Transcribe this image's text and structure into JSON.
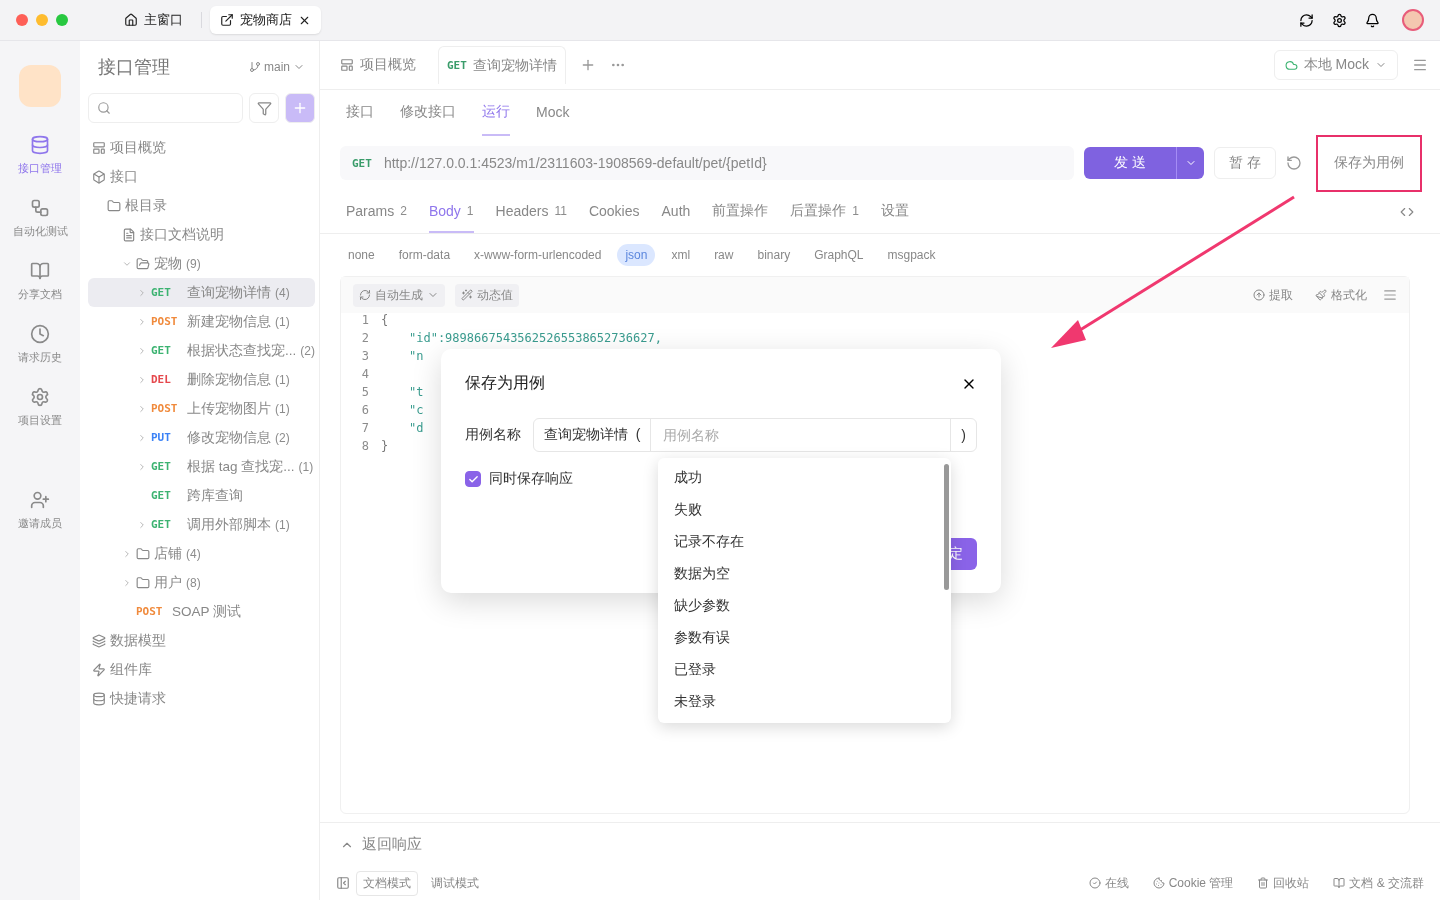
{
  "window": {
    "tabs": [
      {
        "kind": "home",
        "label": "主窗口",
        "selected": false
      },
      {
        "kind": "project",
        "label": "宠物商店",
        "selected": true
      }
    ]
  },
  "rail": [
    {
      "label": "接口管理",
      "selected": true
    },
    {
      "label": "自动化测试",
      "selected": false
    },
    {
      "label": "分享文档",
      "selected": false
    },
    {
      "label": "请求历史",
      "selected": false
    },
    {
      "label": "项目设置",
      "selected": false
    },
    {
      "label": "邀请成员",
      "selected": false
    }
  ],
  "sidebar": {
    "title": "接口管理",
    "branch": "main",
    "tree": [
      {
        "kind": "overview",
        "label": "项目概览"
      },
      {
        "kind": "section",
        "label": "接口",
        "children": [
          {
            "kind": "root",
            "label": "根目录",
            "children": [
              {
                "kind": "doc",
                "label": "接口文档说明"
              },
              {
                "kind": "folder",
                "label": "宠物",
                "count": "(9)",
                "expanded": true,
                "children": [
                  {
                    "kind": "endpoint",
                    "method": "GET",
                    "color": "#3cb371",
                    "label": "查询宠物详情",
                    "count": "(4)",
                    "selected": true,
                    "expandable": true
                  },
                  {
                    "kind": "endpoint",
                    "method": "POST",
                    "color": "#f08a3c",
                    "label": "新建宠物信息",
                    "count": "(1)",
                    "selected": false,
                    "expandable": true
                  },
                  {
                    "kind": "endpoint",
                    "method": "GET",
                    "color": "#3cb371",
                    "label": "根据状态查找宠...",
                    "count": "(2)",
                    "selected": false,
                    "expandable": true
                  },
                  {
                    "kind": "endpoint",
                    "method": "DEL",
                    "color": "#e5484d",
                    "label": "删除宠物信息",
                    "count": "(1)",
                    "selected": false,
                    "expandable": true
                  },
                  {
                    "kind": "endpoint",
                    "method": "POST",
                    "color": "#f08a3c",
                    "label": "上传宠物图片",
                    "count": "(1)",
                    "selected": false,
                    "expandable": true
                  },
                  {
                    "kind": "endpoint",
                    "method": "PUT",
                    "color": "#3b82f6",
                    "label": "修改宠物信息",
                    "count": "(2)",
                    "selected": false,
                    "expandable": true
                  },
                  {
                    "kind": "endpoint",
                    "method": "GET",
                    "color": "#3cb371",
                    "label": "根据 tag 查找宠...",
                    "count": "(1)",
                    "selected": false,
                    "expandable": true
                  },
                  {
                    "kind": "endpoint",
                    "method": "GET",
                    "color": "#3cb371",
                    "label": "跨库查询",
                    "selected": false,
                    "expandable": false
                  },
                  {
                    "kind": "endpoint",
                    "method": "GET",
                    "color": "#3cb371",
                    "label": "调用外部脚本",
                    "count": "(1)",
                    "selected": false,
                    "expandable": true
                  }
                ]
              },
              {
                "kind": "folder",
                "label": "店铺",
                "count": "(4)",
                "expanded": false
              },
              {
                "kind": "folder",
                "label": "用户",
                "count": "(8)",
                "expanded": false
              },
              {
                "kind": "endpoint",
                "method": "POST",
                "color": "#f08a3c",
                "label": "SOAP 测试",
                "selected": false,
                "expandable": false
              }
            ]
          }
        ]
      },
      {
        "kind": "section",
        "label": "数据模型"
      },
      {
        "kind": "section",
        "label": "组件库"
      },
      {
        "kind": "section",
        "label": "快捷请求"
      }
    ]
  },
  "main": {
    "tabs": [
      {
        "kind": "overview",
        "label": "项目概览",
        "selected": false
      },
      {
        "kind": "request",
        "method": "GET",
        "label": "查询宠物详情",
        "selected": true
      }
    ],
    "env": "本地 Mock",
    "subtabs": [
      {
        "label": "接口",
        "selected": false
      },
      {
        "label": "修改接口",
        "selected": false
      },
      {
        "label": "运行",
        "selected": true
      },
      {
        "label": "Mock",
        "selected": false
      }
    ],
    "url": {
      "method": "GET",
      "value": "http://127.0.0.1:4523/m1/2311603-1908569-default/pet/{petId}"
    },
    "send": "发 送",
    "stash": "暂 存",
    "save_case": "保存为用例",
    "param_tabs": [
      {
        "label": "Params",
        "count": "2",
        "selected": false
      },
      {
        "label": "Body",
        "count": "1",
        "selected": true
      },
      {
        "label": "Headers",
        "count": "11",
        "selected": false
      },
      {
        "label": "Cookies",
        "selected": false
      },
      {
        "label": "Auth",
        "selected": false
      },
      {
        "label": "前置操作",
        "selected": false
      },
      {
        "label": "后置操作",
        "count": "1",
        "selected": false
      },
      {
        "label": "设置",
        "selected": false
      }
    ],
    "body_types": [
      {
        "label": "none",
        "selected": false
      },
      {
        "label": "form-data",
        "selected": false
      },
      {
        "label": "x-www-form-urlencoded",
        "selected": false
      },
      {
        "label": "json",
        "selected": true
      },
      {
        "label": "xml",
        "selected": false
      },
      {
        "label": "raw",
        "selected": false
      },
      {
        "label": "binary",
        "selected": false
      },
      {
        "label": "GraphQL",
        "selected": false
      },
      {
        "label": "msgpack",
        "selected": false
      }
    ],
    "editor_tools": {
      "auto": "自动生成",
      "dynamic": "动态值",
      "extract": "提取",
      "format": "格式化"
    },
    "code": [
      {
        "num": "1",
        "text": "{"
      },
      {
        "num": "2",
        "text": "\"id\":98986675435625265538652736627,",
        "indent": true
      },
      {
        "num": "3",
        "text": "\"n",
        "indent": true
      },
      {
        "num": "4"
      },
      {
        "num": "5",
        "text": "\"t",
        "indent": true
      },
      {
        "num": "6",
        "text": "\"c",
        "indent": true
      },
      {
        "num": "7",
        "text": "\"d",
        "indent": true
      },
      {
        "num": "8",
        "text": "}"
      }
    ],
    "response": {
      "title": "返回响应"
    },
    "modes": [
      {
        "label": "文档模式",
        "selected": true
      },
      {
        "label": "调试模式",
        "selected": false
      }
    ],
    "status": [
      "在线",
      "Cookie 管理",
      "回收站",
      "文档 & 交流群"
    ]
  },
  "dialog": {
    "title": "保存为用例",
    "field_label": "用例名称",
    "prefix": "查询宠物详情  (",
    "placeholder": "用例名称",
    "suffix": ")",
    "checkbox": {
      "label": "同时保存响应",
      "checked": true
    },
    "ok": "定",
    "options": [
      "成功",
      "失败",
      "记录不存在",
      "数据为空",
      "缺少参数",
      "参数有误",
      "已登录",
      "未登录"
    ]
  }
}
